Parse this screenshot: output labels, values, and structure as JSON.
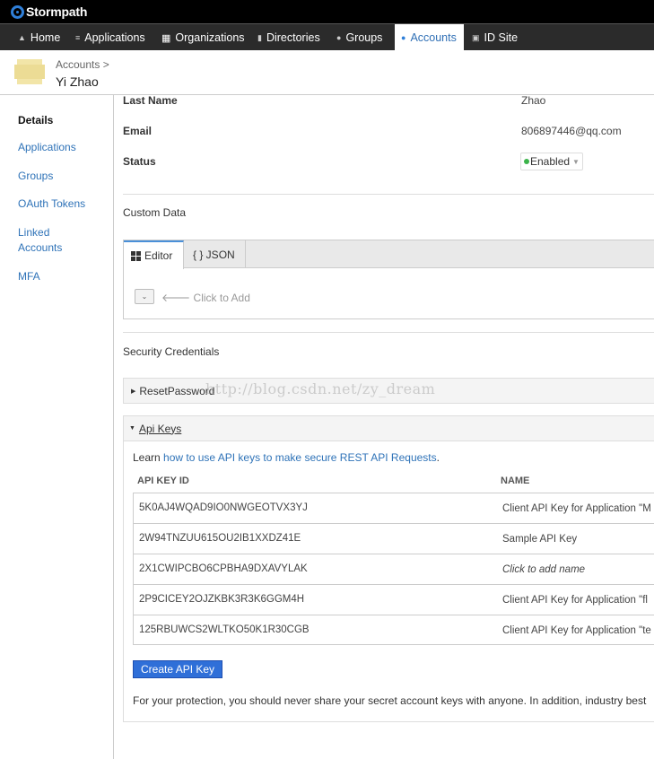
{
  "brand": "Stormpath",
  "nav": {
    "items": [
      {
        "label": "Home",
        "icon": "home-icon"
      },
      {
        "label": "Applications",
        "icon": "stack-icon"
      },
      {
        "label": "Organizations",
        "icon": "grid-icon"
      },
      {
        "label": "Directories",
        "icon": "folder-icon"
      },
      {
        "label": "Groups",
        "icon": "group-icon"
      },
      {
        "label": "Accounts",
        "icon": "user-icon",
        "active": true
      },
      {
        "label": "ID Site",
        "icon": "id-card-icon"
      }
    ]
  },
  "breadcrumb": {
    "parent": "Accounts >",
    "title": "Yi Zhao"
  },
  "sidebar": {
    "items": [
      {
        "label": "Details",
        "current": true
      },
      {
        "label": "Applications"
      },
      {
        "label": "Groups"
      },
      {
        "label": "OAuth Tokens"
      },
      {
        "label": "Linked Accounts"
      },
      {
        "label": "MFA"
      }
    ]
  },
  "fields": {
    "last_name_label": "Last Name",
    "last_name": "Zhao",
    "email_label": "Email",
    "email": "806897446@qq.com",
    "status_label": "Status",
    "status": "Enabled"
  },
  "custom_data": {
    "title": "Custom Data",
    "tab_editor": "Editor",
    "tab_json": "{ } JSON",
    "click_to_add": "Click to Add"
  },
  "security": {
    "title": "Security Credentials",
    "reset_password": "ResetPassword",
    "api_keys_title": "Api Keys",
    "learn_prefix": "Learn ",
    "learn_link": "how to use API keys to make secure REST API Requests",
    "learn_suffix": ".",
    "col_id": "API KEY ID",
    "col_name": "NAME",
    "rows": [
      {
        "id": "5K0AJ4WQAD9IO0NWGEOTVX3YJ",
        "name": "Client API Key for Application \"M"
      },
      {
        "id": "2W94TNZUU615OU2IB1XXDZ41E",
        "name": "Sample API Key"
      },
      {
        "id": "2X1CWIPCBO6CPBHA9DXAVYLAK",
        "name": "Click to add name",
        "placeholder": true
      },
      {
        "id": "2P9CICEY2OJZKBK3R3K6GGM4H",
        "name": "Client API Key for Application \"fl"
      },
      {
        "id": "125RBUWCS2WLTKO50K1R30CGB",
        "name": "Client API Key for Application \"te"
      }
    ],
    "create_button": "Create API Key",
    "protection_note": "For your protection, you should never share your secret account keys with anyone. In addition, industry best"
  },
  "watermark": "http://blog.csdn.net/zy_dream",
  "colors": {
    "accent": "#2f73b8",
    "status_green": "#3bb34a",
    "button_blue": "#2f6fd8"
  }
}
